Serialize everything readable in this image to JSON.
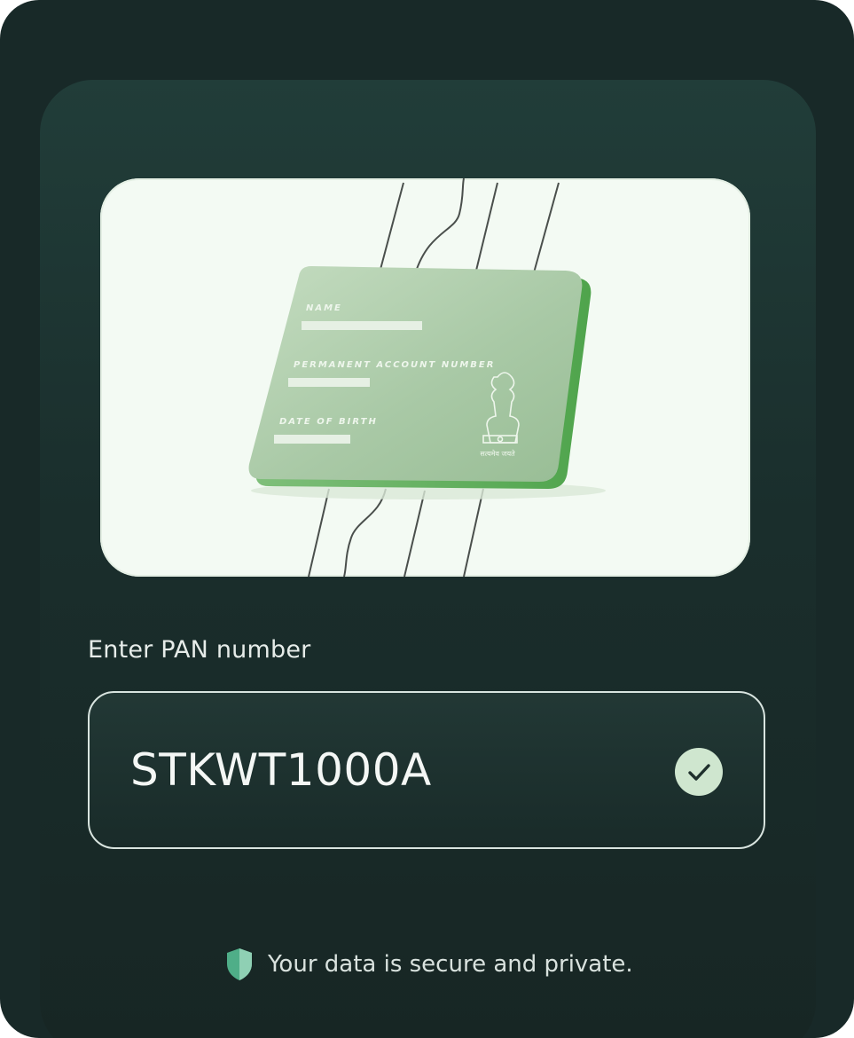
{
  "card_illustration": {
    "name_label": "NAME",
    "pan_label": "PERMANENT ACCOUNT NUMBER",
    "dob_label": "DATE OF BIRTH",
    "emblem_caption": "सत्यमेव जयते"
  },
  "pan_field": {
    "label": "Enter PAN number",
    "value": "STKWT1000A",
    "status_icon": "check-icon",
    "status": "valid"
  },
  "footer": {
    "icon": "shield-icon",
    "text": "Your data is secure and private."
  },
  "colors": {
    "background": "#182928",
    "panel": "#1f3633",
    "accent": "#cfe6cf",
    "card_green": "#a8caa6"
  }
}
